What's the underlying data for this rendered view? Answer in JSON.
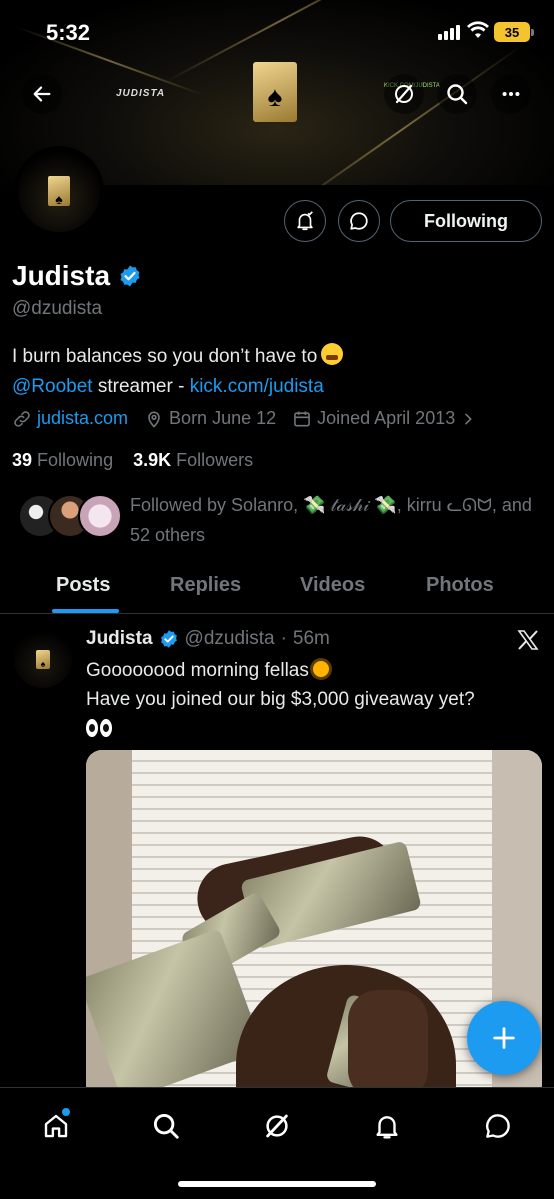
{
  "status_bar": {
    "time": "5:32",
    "battery": "35"
  },
  "banner": {
    "brand_text": "JUDISTA",
    "kick_text": "KICK.COM/JUDISTA"
  },
  "profile": {
    "name": "Judista",
    "handle": "@dzudista",
    "bio_line1": "I burn balances so you don’t have to",
    "bio_mention": "@Roobet",
    "bio_mid": " streamer - ",
    "bio_link": "kick.com/judista",
    "website": "judista.com",
    "born": "Born June 12",
    "joined": "Joined April 2013",
    "following_count": "39",
    "following_label": "Following",
    "followers_count": "3.9K",
    "followers_label": "Followers",
    "followed_by": "Followed by Solanro, 💸 𝓉𝒶𝓈𝒽𝒾 💸, kirru ᓚᘏᗢ, and 52 others",
    "following_button": "Following"
  },
  "tabs": [
    "Posts",
    "Replies",
    "Videos",
    "Photos"
  ],
  "active_tab": "Posts",
  "post": {
    "name": "Judista",
    "handle": "@dzudista",
    "separator": "·",
    "time": "56m",
    "text_line1": "Goooooood morning fellas",
    "text_line2": "Have you joined our big $3,000 giveaway yet?"
  },
  "colors": {
    "accent": "#1d9bf0",
    "background": "#000000",
    "muted": "#71767b",
    "gold": "#d4b86a"
  },
  "icons": [
    "back-arrow-icon",
    "grok-icon",
    "search-icon",
    "more-icon",
    "notify-bell-icon",
    "message-icon",
    "link-icon",
    "location-icon",
    "calendar-icon",
    "chevron-right-icon",
    "verified-icon",
    "x-logo-icon",
    "plus-icon",
    "home-icon",
    "explore-icon",
    "grok-nav-icon",
    "notifications-icon",
    "messages-icon"
  ]
}
